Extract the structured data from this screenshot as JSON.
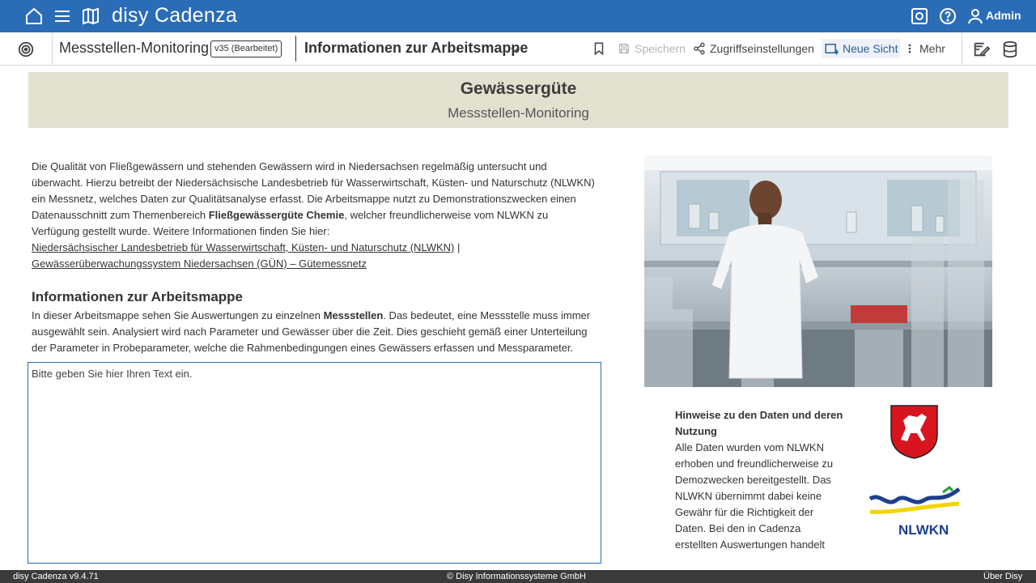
{
  "app": {
    "title": "disy Cadenza",
    "user": "Admin"
  },
  "toolbar": {
    "workbook_name": "Messstellen-Monitoring",
    "version_badge": "v35 (Bearbeitet)",
    "view_title": "Informationen zur Arbeitsmappe",
    "save_label": "Speichern",
    "access_label": "Zugriffseinstellungen",
    "new_view_label": "Neue Sicht",
    "more_label": "Mehr"
  },
  "banner": {
    "title": "Gewässergüte",
    "subtitle": "Messstellen-Monitoring"
  },
  "intro": {
    "text_1": "Die Qualität von Fließgewässern und stehenden Gewässern wird in Niedersachsen regelmäßig untersucht und überwacht. Hierzu betreibt der Niedersächsische Landesbetrieb für Wasserwirtschaft, Küsten- und Naturschutz (NLWKN) ein Messnetz, welches Daten zur Qualitätsanalyse erfasst. Die Arbeitsmappe nutzt zu Demonstrationszwecken einen Datenausschnitt zum Themenbereich ",
    "text_bold": "Fließgewässergüte Chemie",
    "text_2": ", welcher freundlicherweise vom NLWKN zu Verfügung gestellt wurde. Weitere Informationen finden Sie hier:",
    "link_1": "Niedersächsischer Landesbetrieb für Wasserwirtschaft, Küsten- und Naturschutz (NLWKN)",
    "link_sep": " |",
    "link_2": "Gewässerüberwachungssystem Niedersachsen (GÜN) – Gütemessnetz"
  },
  "info": {
    "title": "Informationen zur Arbeitsmappe",
    "text_1": "In dieser Arbeitsmappe sehen Sie Auswertungen zu einzelnen ",
    "text_bold": "Messstellen",
    "text_2": ". Das bedeutet, eine Messstelle muss immer ausgewählt sein. Analysiert wird nach Parameter und Gewässer über die Zeit. Dies geschieht gemäß einer Unterteilung der Parameter in Probeparameter, welche die Rahmenbedingungen eines Gewässers erfassen und Messparameter."
  },
  "editor": {
    "placeholder": "Bitte geben Sie hier Ihren Text ein."
  },
  "notes": {
    "title": "Hinweise zu den Daten und deren Nutzung",
    "body": "Alle Daten wurden vom NLWKN erhoben und freundlicherweise zu Demozwecken bereitgestellt. Das NLWKN übernimmt dabei keine Gewähr für die Richtigkeit der Daten. Bei den in Cadenza erstellten Auswertungen handelt"
  },
  "logos": {
    "nlwkn_text": "NLWKN"
  },
  "footer": {
    "version": "disy Cadenza v9.4.71",
    "copyright": "© Disy Informationssysteme GmbH",
    "about": "Über Disy"
  },
  "colors": {
    "brand_blue": "#2b6cb7",
    "banner_bg": "#e2e1d0",
    "footer_bg": "#3a3a3a"
  },
  "icons": [
    "home-icon",
    "menu-icon",
    "map-icon",
    "settings-icon",
    "help-icon",
    "user-icon",
    "target-icon",
    "bookmark-icon",
    "save-icon",
    "share-icon",
    "new-view-icon",
    "more-icon",
    "edit-icon",
    "database-icon",
    "chevron-down-icon"
  ]
}
